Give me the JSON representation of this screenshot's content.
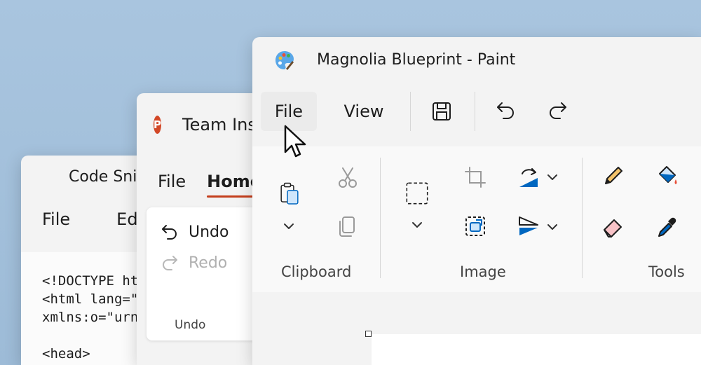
{
  "notepad": {
    "title": "Code Snippet - Notepad",
    "menu": [
      "File",
      "Edit"
    ],
    "code_lines": [
      "<!DOCTYPE html>",
      "<html lang=\"en\"",
      "xmlns:o=\"urn:schemas\"",
      "",
      "<head>"
    ]
  },
  "powerpoint": {
    "title": "Team Insights - PowerPoint",
    "icon_letter": "P",
    "menu": [
      "File",
      "Home"
    ],
    "undo_label": "Undo",
    "redo_label": "Redo",
    "group_label": "Undo"
  },
  "paint": {
    "title": "Magnolia Blueprint - Paint",
    "menu": {
      "file": "File",
      "view": "View"
    },
    "groups": {
      "clipboard": "Clipboard",
      "image": "Image",
      "tools": "Tools"
    }
  },
  "colors": {
    "ppt_accent": "#d24726",
    "paint_accent": "#0067c0"
  }
}
